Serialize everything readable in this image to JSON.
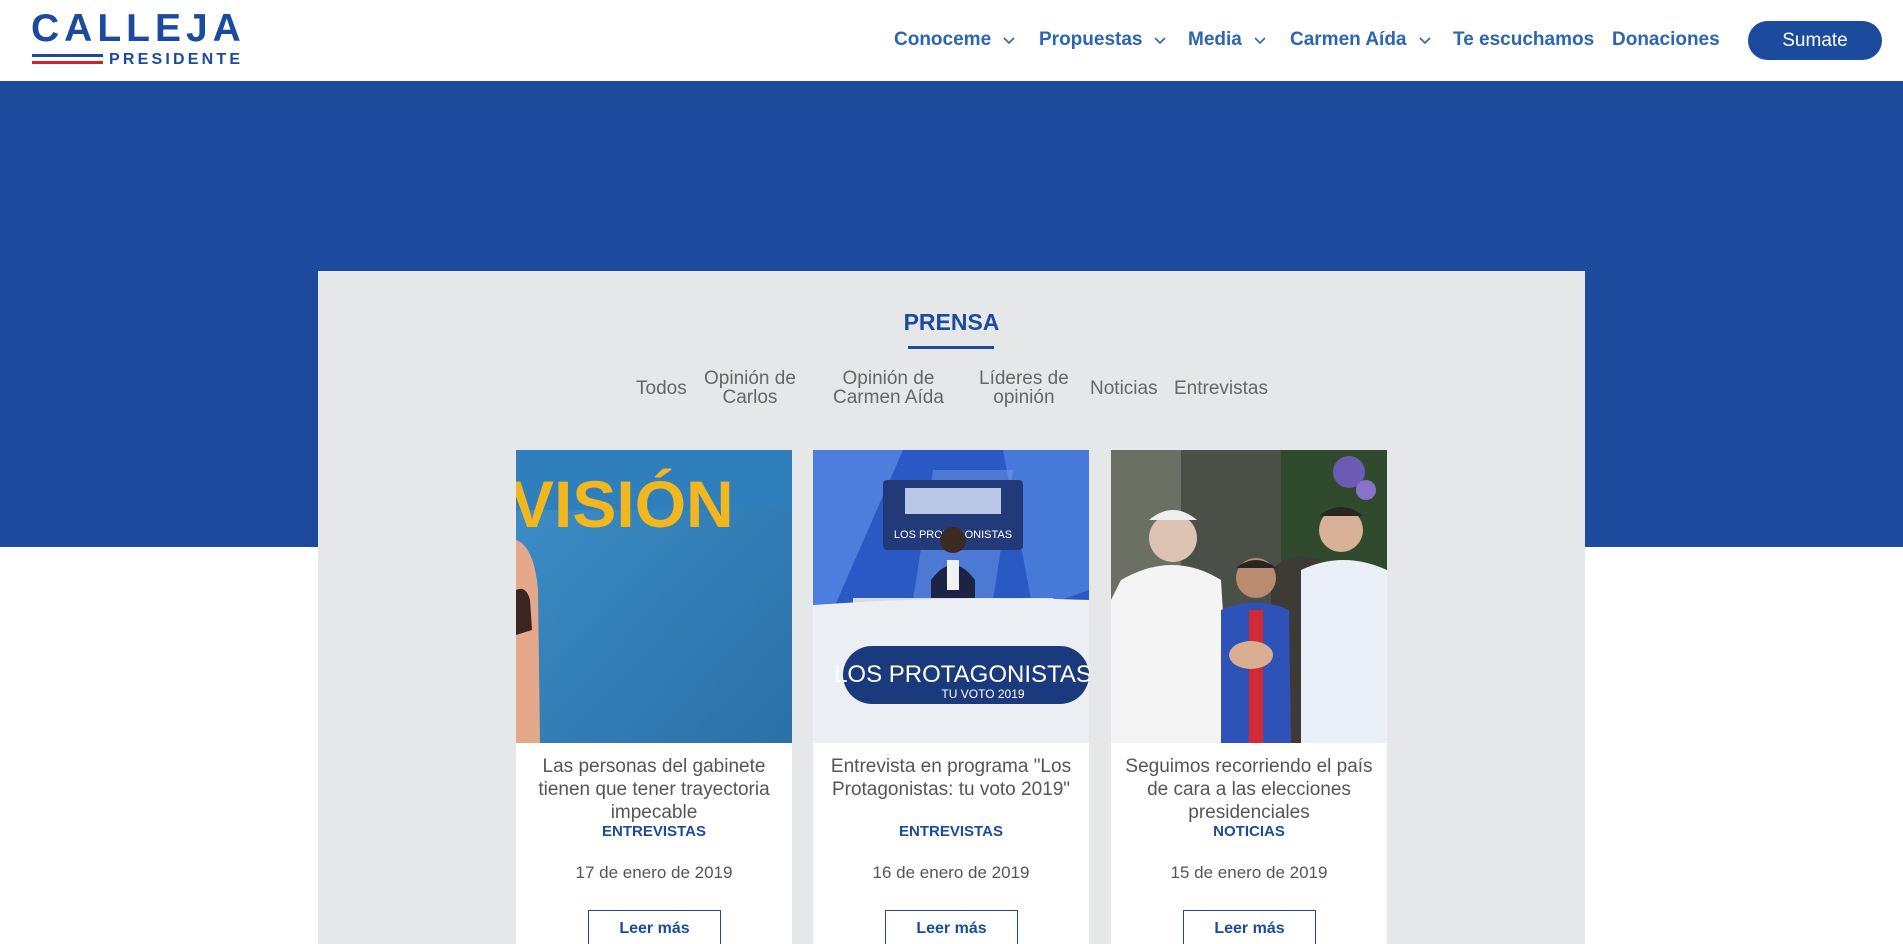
{
  "brand": {
    "name": "CALLEJA",
    "subtitle": "PRESIDENTE",
    "colors": {
      "primary": "#1c4b9e",
      "accent_red": "#d8202b"
    }
  },
  "nav": {
    "items": [
      {
        "label": "Conoceme",
        "has_dropdown": true
      },
      {
        "label": "Propuestas",
        "has_dropdown": true
      },
      {
        "label": "Media",
        "has_dropdown": true
      },
      {
        "label": "Carmen Aída",
        "has_dropdown": true
      },
      {
        "label": "Te escuchamos",
        "has_dropdown": false
      },
      {
        "label": "Donaciones",
        "has_dropdown": false
      }
    ],
    "cta_label": "Sumate"
  },
  "section": {
    "title": "PRENSA",
    "filters": [
      {
        "line1": "Todos",
        "line2": ""
      },
      {
        "line1": "Opinión de",
        "line2": "Carlos"
      },
      {
        "line1": "Opinión de",
        "line2": "Carmen Aída"
      },
      {
        "line1": "Líderes de",
        "line2": "opinión"
      },
      {
        "line1": "Noticias",
        "line2": ""
      },
      {
        "line1": "Entrevistas",
        "line2": ""
      }
    ]
  },
  "cards": [
    {
      "title": "Las personas del gabinete tienen que tener trayectoria impecable",
      "category": "ENTREVISTAS",
      "date": "17 de enero de 2019",
      "button": "Leer más",
      "image_text": "VISIÓN"
    },
    {
      "title": "Entrevista en programa \"Los Protagonistas: tu voto 2019\"",
      "category": "ENTREVISTAS",
      "date": "16 de enero de 2019",
      "button": "Leer más",
      "image_text": "LOS PROTAGONISTAS",
      "image_subtext": "TU VOTO 2019"
    },
    {
      "title": "Seguimos recorriendo el país de cara a las elecciones presidenciales",
      "category": "NOTICIAS",
      "date": "15 de enero de 2019",
      "button": "Leer más"
    }
  ]
}
